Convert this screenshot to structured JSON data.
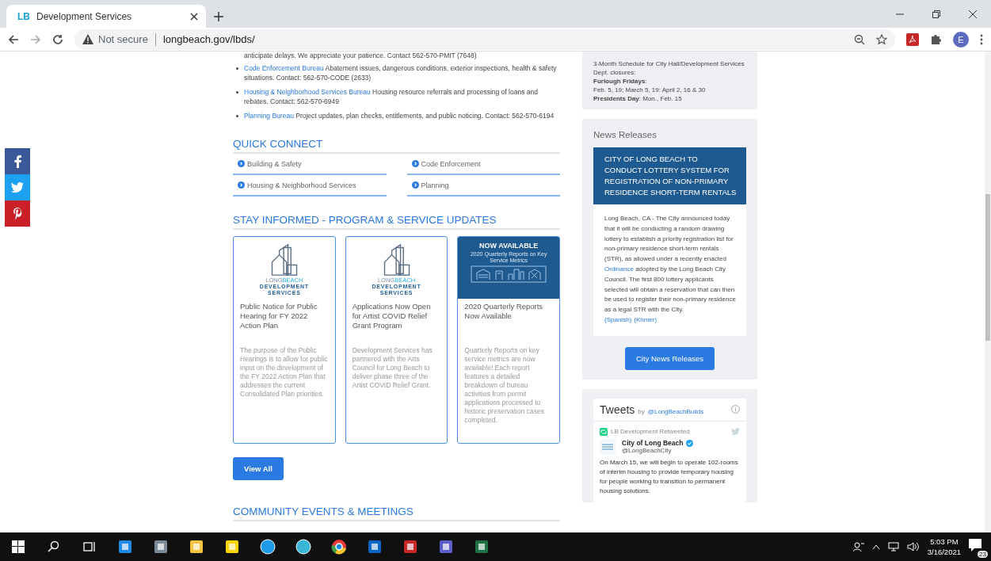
{
  "browser": {
    "logo": "LB",
    "tab_title": "Development Services",
    "security": "Not secure",
    "url": "longbeach.gov/lbds/",
    "avatar": "E"
  },
  "main": {
    "intro_tail": "anticipate delays.  We appreciate your patience. Contact 562-570-PMIT (7648)",
    "bureaus": [
      {
        "link": "Code Enforcement Bureau",
        "text": "Abatement issues, dangerous conditions, exterior inspections, health & safety situations. Contact: 562-570-CODE (2633)"
      },
      {
        "link": "Housing & Neighborhood Services Bureau",
        "text": "Housing resource referrals and processing of loans and rebates. Contact: 562-570-6949"
      },
      {
        "link": "Planning Bureau",
        "text": "Project updates, plan checks, entitlements, and public noticing. Contact: 562-570-6194"
      }
    ],
    "quick_connect": {
      "title": "QUICK CONNECT",
      "links": [
        "Building & Safety",
        "Code Enforcement",
        "Housing & Neighborhood Services",
        "Planning"
      ]
    },
    "stay_informed": {
      "title": "STAY INFORMED - PROGRAM & SERVICE UPDATES",
      "cards": [
        {
          "kind": "logo",
          "logo_a": "LONG",
          "logo_b": "BEACH",
          "logo_name": "DEVELOPMENT SERVICES",
          "title": "Public Notice for Public Hearing for FY 2022 Action Plan",
          "body": "The purpose of the Public Hearings is to allow for public input on the development of the FY 2022 Action Plan that addresses the current Consolidated Plan priorities."
        },
        {
          "kind": "logo",
          "logo_a": "LONG",
          "logo_b": "BEACH",
          "logo_name": "DEVELOPMENT SERVICES",
          "title": "Applications Now Open for Artist COVID Relief Grant Program",
          "body": "Development Services has partnered with the Arts Council for Long Beach to deliver phase three of the Artist COVID Relief Grant."
        },
        {
          "kind": "banner",
          "banner_title": "NOW AVAILABLE",
          "banner_sub": "2020 Quarterly Reports on Key Service Metrics",
          "title": "2020 Quarterly Reports Now Available",
          "body": "Quarterly Reports on key service metrics are now available! Each report features a detailed breakdown of bureau activities from permit applications processed to historic preservation cases completed."
        }
      ],
      "button": "View All"
    },
    "community_title": "COMMUNITY EVENTS & MEETINGS"
  },
  "sidebar": {
    "schedule": [
      "3-Month Schedule for City Hall/Development Services Dept. closures:",
      "**Furlough Fridays**:",
      "Feb. 5, 19; March 5, 19: April 2, 16 & 30",
      "**Presidents Day**: Mon., Feb. 15"
    ],
    "news": {
      "heading": "News Releases",
      "headline": "CITY OF LONG BEACH TO CONDUCT LOTTERY SYSTEM FOR REGISTRATION OF NON-PRIMARY RESIDENCE SHORT-TERM RENTALS",
      "body_before": "Long Beach, CA - The City announced today that it will be conducting a random drawing lottery to establish a priority registration list for non-primary residence short-term rentals (STR), as allowed under a recently enacted",
      "link": "Ordinance",
      "body_after": "adopted by the Long Beach City Council. The first 800 lottery applicants selected will obtain a reservation that can then be used to register their non-primary residence as a legal STR with the City.",
      "languages": [
        "(Spanish)",
        "(Khmer)"
      ],
      "button": "City News Releases"
    },
    "tweets": {
      "title": "Tweets",
      "by": "by",
      "handle": "@LongBeachBuilds",
      "retweeted": "LB Development Retweeted",
      "name": "City of Long Beach",
      "user": "@LongBeachCity",
      "text": "On March 15, we will begin to operate 102-rooms of interim housing to provide temporary housing for people working to transition to permanent housing solutions."
    }
  },
  "taskbar": {
    "time": "5:03 PM",
    "date": "3/16/2021",
    "notifications": "23"
  }
}
